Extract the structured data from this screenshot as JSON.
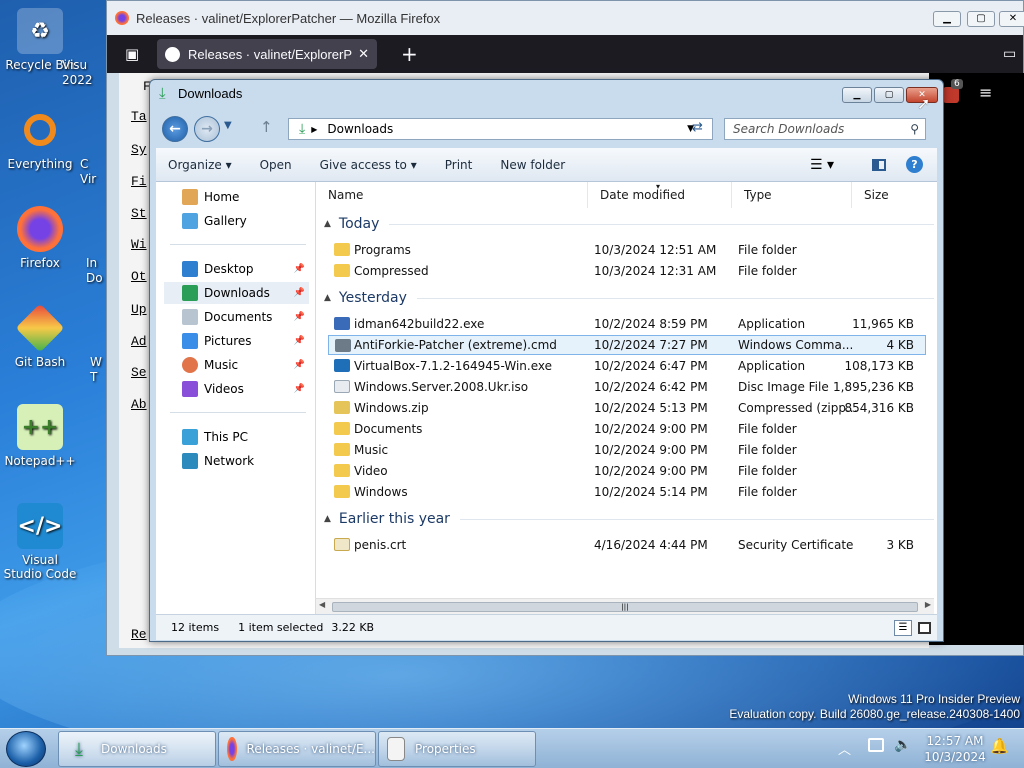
{
  "desktop": {
    "icons": [
      {
        "label": "Recycle Bin",
        "icon": "recycle-bin-icon"
      },
      {
        "label": "Everything",
        "icon": "everything-search-icon"
      },
      {
        "label": "Firefox",
        "icon": "firefox-icon"
      },
      {
        "label": "Git Bash",
        "icon": "git-bash-icon"
      },
      {
        "label": "Notepad++",
        "icon": "notepad-plus-plus-icon"
      },
      {
        "label": "Visual Studio Code",
        "icon": "vscode-icon"
      }
    ],
    "partial_labels": [
      "Visu",
      "2022",
      "C",
      "Vir",
      "In",
      "Do",
      "W",
      "T"
    ],
    "watermark": {
      "line1": "Windows 11 Pro Insider Preview",
      "line2": "Evaluation copy. Build 26080.ge_release.240308-1400"
    }
  },
  "firefox": {
    "title": "Releases · valinet/ExplorerPatcher — Mozilla Firefox",
    "tab_label": "Releases · valinet/ExplorerPatch",
    "new_tab": "+",
    "badge": "6",
    "page_links": [
      "Ta",
      "Sy",
      "Fi",
      "St",
      "Wi",
      "Ot",
      "Up",
      "Ad",
      "Se",
      "Ab",
      "Re"
    ],
    "page_letter_top": "F"
  },
  "explorer": {
    "title": "Downloads",
    "address": "Downloads",
    "search_placeholder": "Search Downloads",
    "commands": {
      "organize": "Organize",
      "open": "Open",
      "give_access": "Give access to",
      "print": "Print",
      "new_folder": "New folder"
    },
    "nav": {
      "home": "Home",
      "gallery": "Gallery",
      "desktop": "Desktop",
      "downloads": "Downloads",
      "documents": "Documents",
      "pictures": "Pictures",
      "music": "Music",
      "videos": "Videos",
      "this_pc": "This PC",
      "network": "Network"
    },
    "columns": {
      "name": "Name",
      "date": "Date modified",
      "type": "Type",
      "size": "Size"
    },
    "groups": {
      "today": "Today",
      "yesterday": "Yesterday",
      "earlier": "Earlier this year"
    },
    "files": [
      {
        "name": "Programs",
        "date": "10/3/2024 12:51 AM",
        "type": "File folder",
        "size": "",
        "icon": "folder-icon"
      },
      {
        "name": "Compressed",
        "date": "10/3/2024 12:31 AM",
        "type": "File folder",
        "size": "",
        "icon": "folder-icon"
      },
      {
        "name": "idman642build22.exe",
        "date": "10/2/2024 8:59 PM",
        "type": "Application",
        "size": "11,965 KB",
        "icon": "exe-icon"
      },
      {
        "name": "AntiForkie-Patcher (extreme).cmd",
        "date": "10/2/2024 7:27 PM",
        "type": "Windows Comma...",
        "size": "4 KB",
        "icon": "cmd-icon"
      },
      {
        "name": "VirtualBox-7.1.2-164945-Win.exe",
        "date": "10/2/2024 6:47 PM",
        "type": "Application",
        "size": "108,173 KB",
        "icon": "virtualbox-icon"
      },
      {
        "name": "Windows.Server.2008.Ukr.iso",
        "date": "10/2/2024 6:42 PM",
        "type": "Disc Image File",
        "size": "1,895,236 KB",
        "icon": "iso-icon"
      },
      {
        "name": "Windows.zip",
        "date": "10/2/2024 5:13 PM",
        "type": "Compressed (zipp...",
        "size": "854,316 KB",
        "icon": "zip-icon"
      },
      {
        "name": "Documents",
        "date": "10/2/2024 9:00 PM",
        "type": "File folder",
        "size": "",
        "icon": "folder-icon"
      },
      {
        "name": "Music",
        "date": "10/2/2024 9:00 PM",
        "type": "File folder",
        "size": "",
        "icon": "folder-icon"
      },
      {
        "name": "Video",
        "date": "10/2/2024 9:00 PM",
        "type": "File folder",
        "size": "",
        "icon": "folder-icon"
      },
      {
        "name": "Windows",
        "date": "10/2/2024 5:14 PM",
        "type": "File folder",
        "size": "",
        "icon": "folder-icon"
      },
      {
        "name": "penis.crt",
        "date": "4/16/2024 4:44 PM",
        "type": "Security Certificate",
        "size": "3 KB",
        "icon": "certificate-icon"
      }
    ],
    "status": {
      "count": "12 items",
      "selection": "1 item selected",
      "size": "3.22 KB"
    }
  },
  "taskbar": {
    "buttons": [
      {
        "label": "Downloads",
        "icon": "downloads-icon"
      },
      {
        "label": "Releases · valinet/E...",
        "icon": "firefox-icon"
      },
      {
        "label": "Properties",
        "icon": "properties-icon"
      }
    ],
    "time": "12:57 AM",
    "date": "10/3/2024"
  },
  "colors": {
    "accent": "#3b78c3",
    "selection": "#e5f1fb",
    "folder": "#f3c94e"
  }
}
